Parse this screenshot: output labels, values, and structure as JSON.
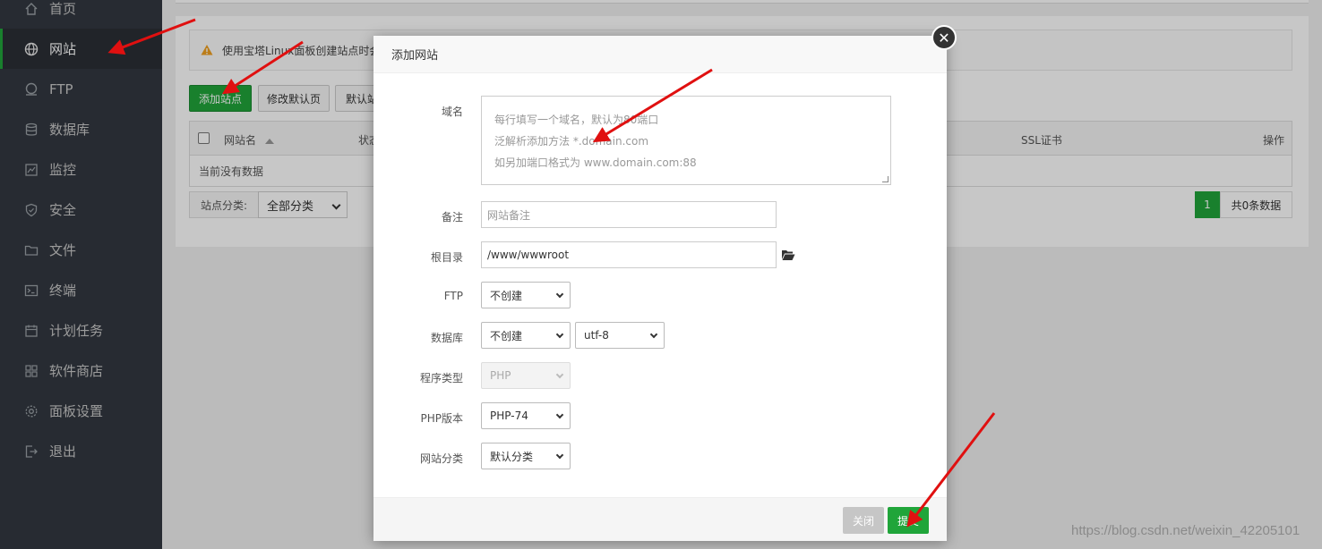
{
  "sidebar": {
    "items": [
      {
        "label": "首页",
        "icon": "home-icon"
      },
      {
        "label": "网站",
        "icon": "globe-icon",
        "active": true
      },
      {
        "label": "FTP",
        "icon": "ftp-icon"
      },
      {
        "label": "数据库",
        "icon": "database-icon"
      },
      {
        "label": "监控",
        "icon": "monitor-icon"
      },
      {
        "label": "安全",
        "icon": "shield-icon"
      },
      {
        "label": "文件",
        "icon": "folder-icon"
      },
      {
        "label": "终端",
        "icon": "terminal-icon"
      },
      {
        "label": "计划任务",
        "icon": "calendar-icon"
      },
      {
        "label": "软件商店",
        "icon": "grid-icon"
      },
      {
        "label": "面板设置",
        "icon": "gear-icon"
      },
      {
        "label": "退出",
        "icon": "logout-icon"
      }
    ]
  },
  "main": {
    "alert_text": "使用宝塔Linux面板创建站点时会",
    "buttons": {
      "add_site": "添加站点",
      "modify_default": "修改默认页",
      "default_site": "默认站"
    },
    "table": {
      "headers": {
        "site_name": "网站名",
        "status": "状态",
        "ssl": "SSL证书",
        "actions": "操作"
      },
      "empty_text": "当前没有数据"
    },
    "category": {
      "label": "站点分类:",
      "selected": "全部分类"
    },
    "pager": {
      "page": "1",
      "total": "共0条数据"
    }
  },
  "modal": {
    "title": "添加网站",
    "close_glyph": "✕",
    "fields": {
      "domain": {
        "label": "域名",
        "placeholder_lines": [
          "每行填写一个域名，默认为80端口",
          "泛解析添加方法 *.domain.com",
          "如另加端口格式为 www.domain.com:88"
        ]
      },
      "remark": {
        "label": "备注",
        "placeholder": "网站备注"
      },
      "root": {
        "label": "根目录",
        "value": "/www/wwwroot"
      },
      "ftp": {
        "label": "FTP",
        "value": "不创建"
      },
      "database": {
        "label": "数据库",
        "value": "不创建",
        "charset": "utf-8"
      },
      "program_type": {
        "label": "程序类型",
        "value": "PHP"
      },
      "php_version": {
        "label": "PHP版本",
        "value": "PHP-74"
      },
      "site_category": {
        "label": "网站分类",
        "value": "默认分类"
      }
    },
    "footer": {
      "close": "关闭",
      "submit": "提交"
    }
  },
  "watermark": "https://blog.csdn.net/weixin_42205101",
  "colors": {
    "sidebar_bg": "#333840",
    "accent_green": "#20a53a",
    "arrow_red": "#e01010",
    "close_btn_gray": "#c6c6c6"
  }
}
